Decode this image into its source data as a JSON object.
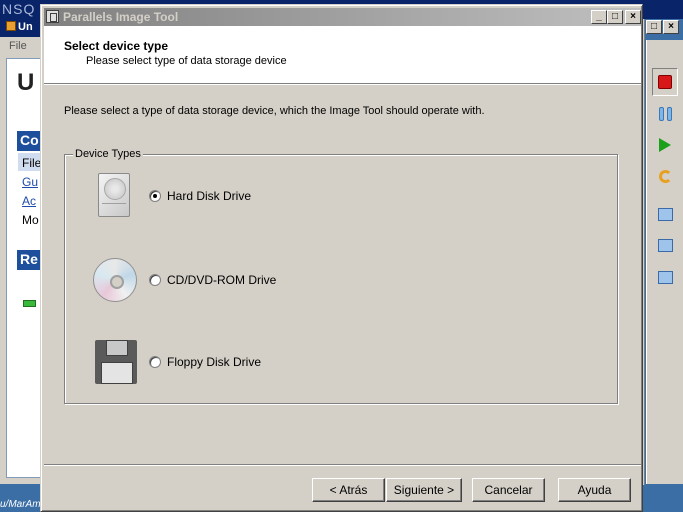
{
  "background_app": {
    "logo": "NSQ",
    "window_title": "Un",
    "menu": "File",
    "page": {
      "heading": "U",
      "section1": "Co",
      "item_file": "File",
      "link_gu": "Gu",
      "link_ac": "Ac",
      "item_mo": "Mo",
      "section2": "Re"
    },
    "status_text": "u/MarAmLite",
    "close_glyph": "×"
  },
  "toolbar": {
    "icons": [
      "stop-icon",
      "pause-icon",
      "play-icon",
      "reset-icon",
      "fit-window-icon",
      "screenshot-icon",
      "snapshot-icon"
    ]
  },
  "dialog": {
    "title": "Parallels Image Tool",
    "controls": {
      "minimize": "_",
      "maximize": "□",
      "close": "×"
    },
    "header": {
      "title": "Select device type",
      "subtitle": "Please select type of data storage device"
    },
    "instruction": "Please select a type of data storage device, which the Image Tool should operate with.",
    "group_label": "Device Types",
    "devices": [
      {
        "label": "Hard Disk Drive",
        "icon": "hard-disk-icon",
        "selected": true
      },
      {
        "label": "CD/DVD-ROM Drive",
        "icon": "cd-rom-icon",
        "selected": false
      },
      {
        "label": "Floppy Disk Drive",
        "icon": "floppy-disk-icon",
        "selected": false
      }
    ],
    "buttons": {
      "back": "< Atrás",
      "next": "Siguiente >",
      "cancel": "Cancelar",
      "help": "Ayuda"
    }
  }
}
